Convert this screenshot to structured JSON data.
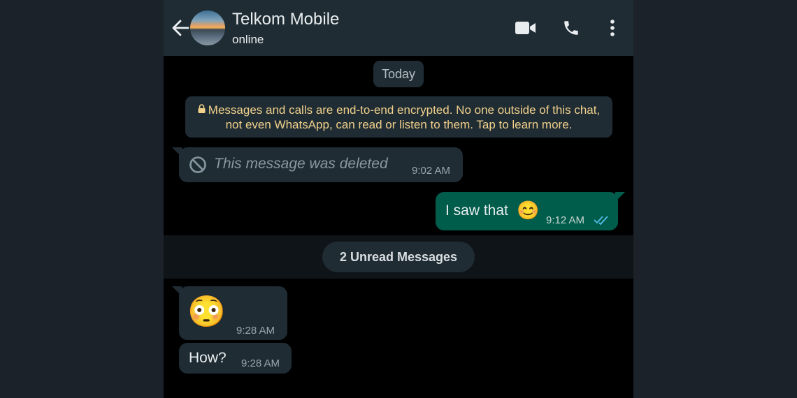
{
  "header": {
    "back_icon": "arrow-left-icon",
    "contact_name": "Telkom Mobile",
    "contact_status": "online",
    "actions": [
      "video-call-icon",
      "phone-icon",
      "more-vert-icon"
    ]
  },
  "chat": {
    "date_label": "Today",
    "encryption_notice": "Messages and calls are end-to-end encrypted. No one outside of this chat, not even WhatsApp, can read or listen to them. Tap to learn more.",
    "messages": [
      {
        "direction": "in",
        "text": "This message was deleted",
        "time": "9:02 AM",
        "deleted": true
      },
      {
        "direction": "out",
        "text": "I saw that",
        "emoji": "😊",
        "time": "9:12 AM",
        "status": "read"
      },
      {
        "direction": "in",
        "emoji": "😳",
        "time": "9:28 AM"
      },
      {
        "direction": "in",
        "text": "How?",
        "time": "9:28 AM"
      }
    ],
    "unread_label": "2 Unread Messages"
  },
  "colors": {
    "header_bg": "#1f2c34",
    "incoming_bubble": "#1f2c34",
    "outgoing_bubble": "#005c4b",
    "notice_text": "#f1d08a",
    "read_ticks": "#53bdeb"
  }
}
